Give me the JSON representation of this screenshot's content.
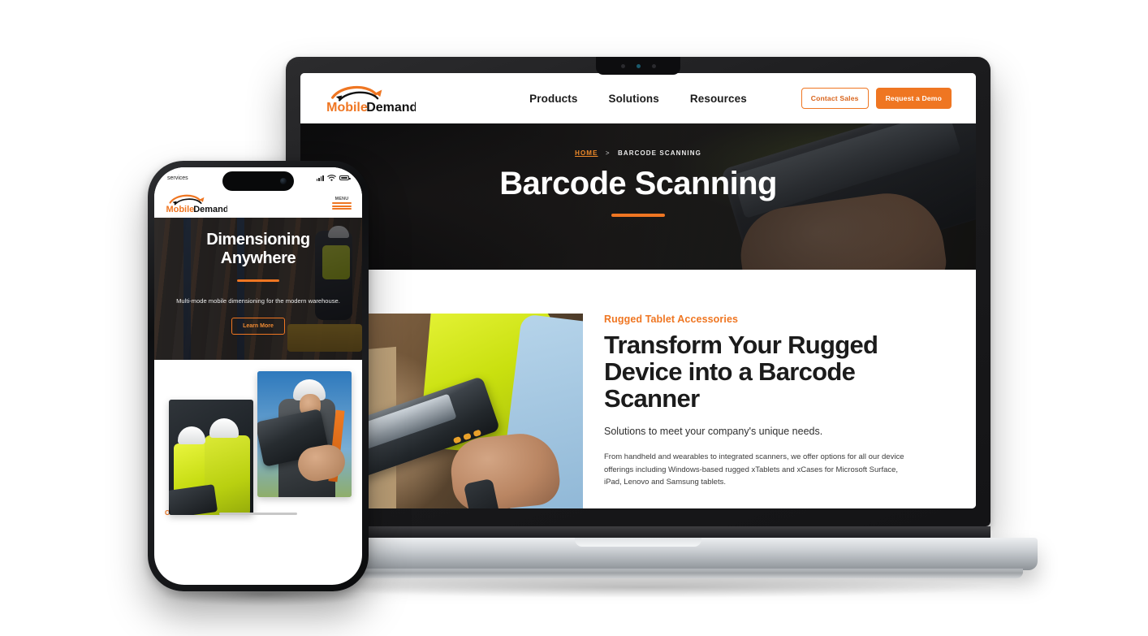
{
  "colors": {
    "brand_orange": "#ef7622",
    "brand_orange_dark": "#d9641b",
    "text_dark": "#1b1b1b",
    "hero_dark": "#14141a"
  },
  "laptop": {
    "site_header": {
      "logo_primary": "Mobile",
      "logo_secondary": "Demand",
      "nav": [
        {
          "label": "Products"
        },
        {
          "label": "Solutions"
        },
        {
          "label": "Resources"
        }
      ],
      "contact_sales_label": "Contact Sales",
      "request_demo_label": "Request a Demo"
    },
    "hero": {
      "breadcrumb_home": "HOME",
      "breadcrumb_separator": ">",
      "breadcrumb_current": "BARCODE SCANNING",
      "title": "Barcode Scanning"
    },
    "content": {
      "eyebrow": "Rugged Tablet Accessories",
      "headline": "Transform Your Rugged Device into a Barcode Scanner",
      "subhead": "Solutions to meet your company's unique needs.",
      "body": "From handheld and wearables to integrated scanners, we offer options for all our device offerings including Windows-based rugged xTablets and xCases for Microsoft Surface, iPad, Lenovo and Samsung tablets."
    }
  },
  "phone": {
    "status_bar": {
      "carrier": "services",
      "signal_icon": "cellular-signal-icon",
      "wifi_icon": "wifi-icon",
      "battery_icon": "battery-icon"
    },
    "header": {
      "logo_primary": "Mobile",
      "logo_secondary": "Demand",
      "menu_label": "MENU"
    },
    "hero": {
      "title_line1": "Dimensioning",
      "title_line2": "Anywhere",
      "subtitle": "Multi-mode mobile dimensioning for the modern warehouse.",
      "cta_label": "Learn More"
    },
    "products": {
      "label": "Our Products"
    }
  }
}
